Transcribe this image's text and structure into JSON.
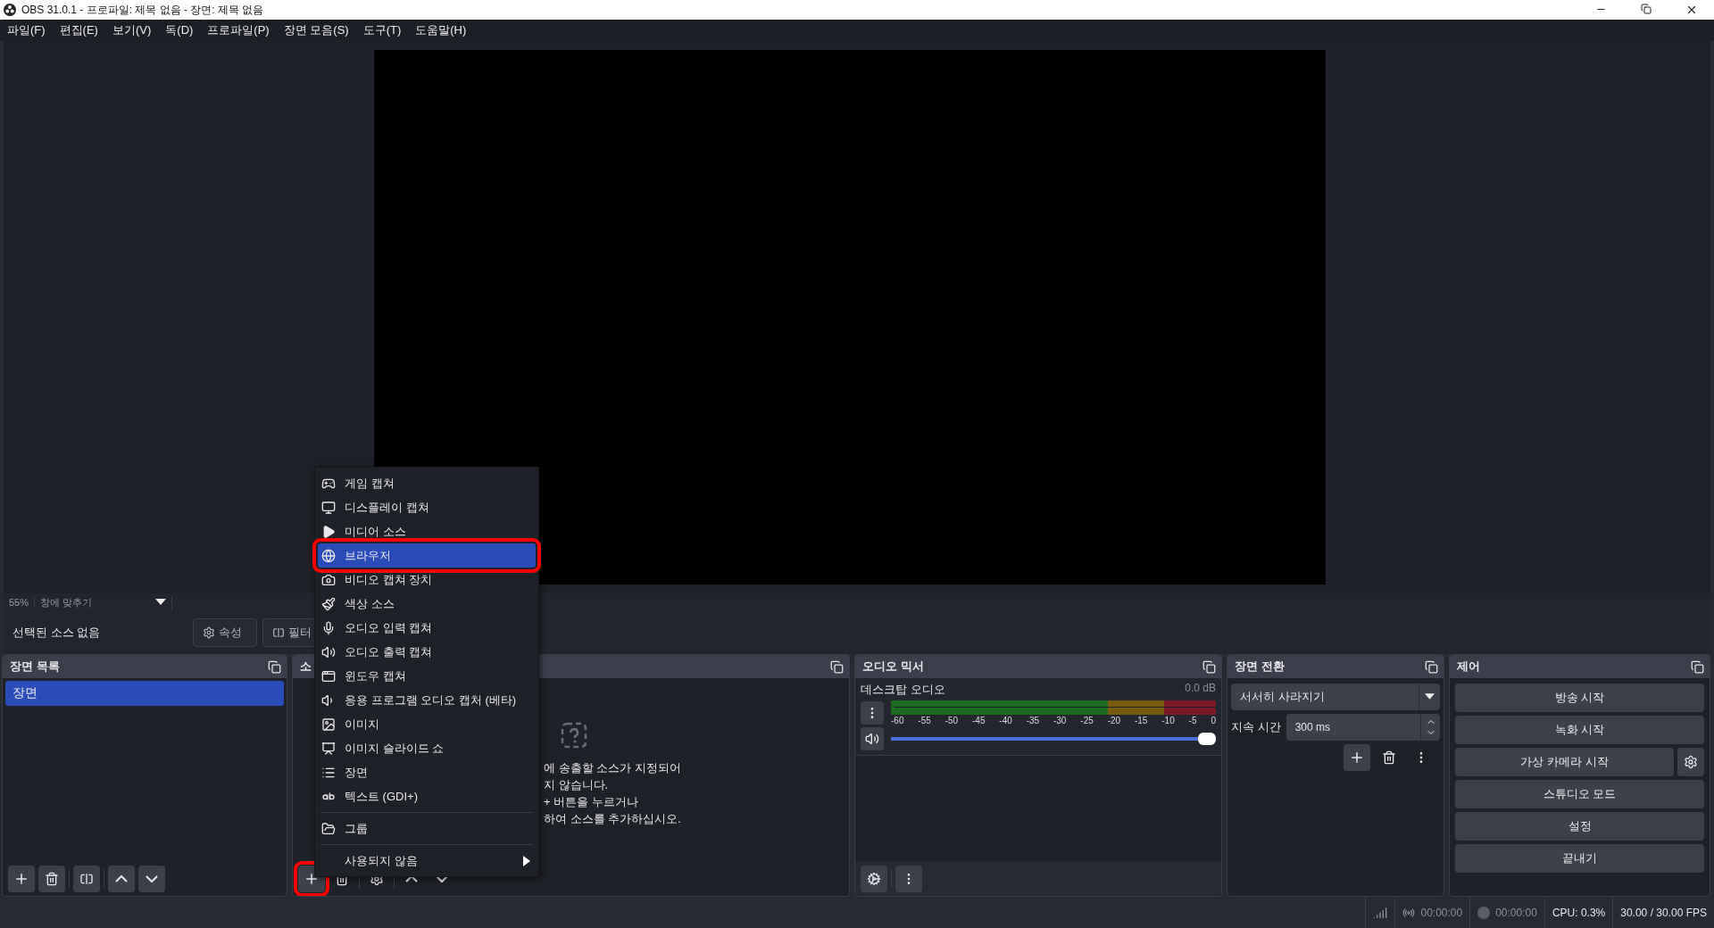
{
  "window": {
    "title": "OBS 31.0.1 - 프로파일: 제목 없음 - 장면: 제목 없음"
  },
  "menu_bar": [
    "파일(F)",
    "편집(E)",
    "보기(V)",
    "독(D)",
    "프로파일(P)",
    "장면 모음(S)",
    "도구(T)",
    "도움말(H)"
  ],
  "preview": {
    "zoom": "55%",
    "scale_mode": "창에 맞추기"
  },
  "context_bar": {
    "label": "선택된 소스 없음",
    "buttons": [
      "속성",
      "필터"
    ]
  },
  "scenes": {
    "title": "장면 목록",
    "items": [
      {
        "label": "장면",
        "selected": true
      }
    ]
  },
  "sources": {
    "title": "소",
    "empty_text": [
      "에 송출할 소스가 지정되어",
      "지 않습니다.",
      "+ 버튼을 누르거나",
      "하여 소스를 추가하십시오."
    ],
    "add_button": {
      "highlighted": true
    }
  },
  "add_source_menu": [
    {
      "kind": "item",
      "label": "게임 캡쳐",
      "selected": false,
      "highlighted": false
    },
    {
      "kind": "item",
      "label": "디스플레이 캡쳐",
      "selected": false,
      "highlighted": false
    },
    {
      "kind": "item",
      "label": "미디어 소스",
      "selected": false,
      "highlighted": false
    },
    {
      "kind": "item",
      "label": "브라우저",
      "selected": true,
      "highlighted": true
    },
    {
      "kind": "item",
      "label": "비디오 캡쳐 장치",
      "selected": false,
      "highlighted": false
    },
    {
      "kind": "item",
      "label": "색상 소스",
      "selected": false,
      "highlighted": false
    },
    {
      "kind": "item",
      "label": "오디오 입력 캡쳐",
      "selected": false,
      "highlighted": false
    },
    {
      "kind": "item",
      "label": "오디오 출력 캡쳐",
      "selected": false,
      "highlighted": false
    },
    {
      "kind": "item",
      "label": "윈도우 캡쳐",
      "selected": false,
      "highlighted": false
    },
    {
      "kind": "item",
      "label": "응용 프로그램 오디오 캡처 (베타)",
      "selected": false,
      "highlighted": false
    },
    {
      "kind": "item",
      "label": "이미지",
      "selected": false,
      "highlighted": false
    },
    {
      "kind": "item",
      "label": "이미지 슬라이드 쇼",
      "selected": false,
      "highlighted": false
    },
    {
      "kind": "item",
      "label": "장면",
      "selected": false,
      "highlighted": false
    },
    {
      "kind": "item",
      "label": "텍스트 (GDI+)",
      "selected": false,
      "highlighted": false
    },
    {
      "kind": "separator"
    },
    {
      "kind": "item",
      "label": "그룹",
      "selected": false,
      "highlighted": false
    },
    {
      "kind": "separator"
    },
    {
      "kind": "submenu",
      "label": "사용되지 않음",
      "selected": false,
      "highlighted": false
    }
  ],
  "audio_mixer": {
    "title": "오디오 믹서",
    "channels": [
      {
        "name": "데스크탑 오디오",
        "reading": "0.0 dB",
        "level": 1
      }
    ],
    "scale": [
      "-60",
      "-55",
      "-50",
      "-45",
      "-40",
      "-35",
      "-30",
      "-25",
      "-20",
      "-15",
      "-10",
      "-5",
      "0"
    ]
  },
  "scene_transitions": {
    "title": "장면 전환",
    "transition": "서서히 사라지기",
    "duration_label": "지속 시간",
    "duration": "300 ms"
  },
  "controls": {
    "title": "제어",
    "buttons": [
      "방송 시작",
      "녹화 시작",
      "가상 카메라 시작",
      "스튜디오 모드",
      "설정",
      "끝내기"
    ]
  },
  "status_bar": {
    "stream_time": "00:00:00",
    "record_time": "00:00:00",
    "cpu": "CPU: 0.3%",
    "fps": "30.00 / 30.00 FPS"
  }
}
